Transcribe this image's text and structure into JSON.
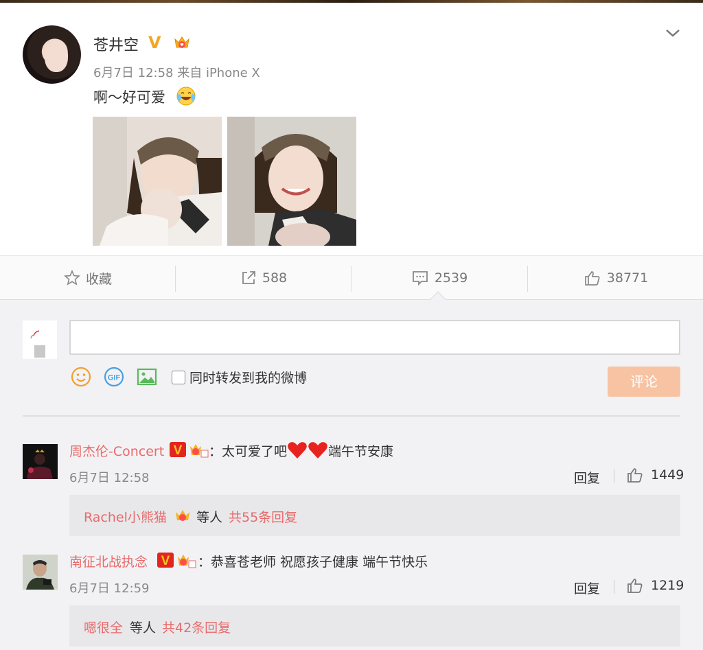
{
  "post": {
    "username": "苍井空",
    "verified_badge": "V",
    "meta": "6月7日 12:58 来自 iPhone X",
    "text": "啊～好可爱",
    "emoji": "laughing-crying-emoji",
    "images": [
      "photo-mother-kissing-baby",
      "photo-mother-smiling-baby"
    ]
  },
  "actions": {
    "favorite_label": "收藏",
    "repost_count": "588",
    "comment_count": "2539",
    "like_count": "38771"
  },
  "composer": {
    "placeholder": "",
    "repost_checkbox_label": "同时转发到我的微博",
    "submit_label": "评论",
    "tools": [
      "smiley-icon",
      "gif-icon",
      "image-icon"
    ]
  },
  "comments": [
    {
      "name": "周杰伦-Concert",
      "separator": "：",
      "text_before": "太可爱了吧",
      "text_after": "端午节安康",
      "time": "6月7日 12:58",
      "reply_label": "回复",
      "likes": "1449",
      "sub": {
        "name": "Rachel小熊猫",
        "etc": "等人",
        "count_label": "共55条回复"
      }
    },
    {
      "name": "南征北战执念",
      "separator": "：",
      "text": "恭喜苍老师 祝愿孩子健康 端午节快乐",
      "time": "6月7日 12:59",
      "reply_label": "回复",
      "likes": "1219",
      "sub": {
        "name": "嗯很全",
        "etc": "等人",
        "count_label": "共42条回复"
      }
    }
  ],
  "colors": {
    "accent_name": "#e86a6a",
    "verified": "#f2a626",
    "submit_disabled": "#f8c3a3",
    "gif_icon": "#4a9fe0",
    "image_icon": "#5cb85c",
    "smiley_icon": "#f0a030"
  }
}
